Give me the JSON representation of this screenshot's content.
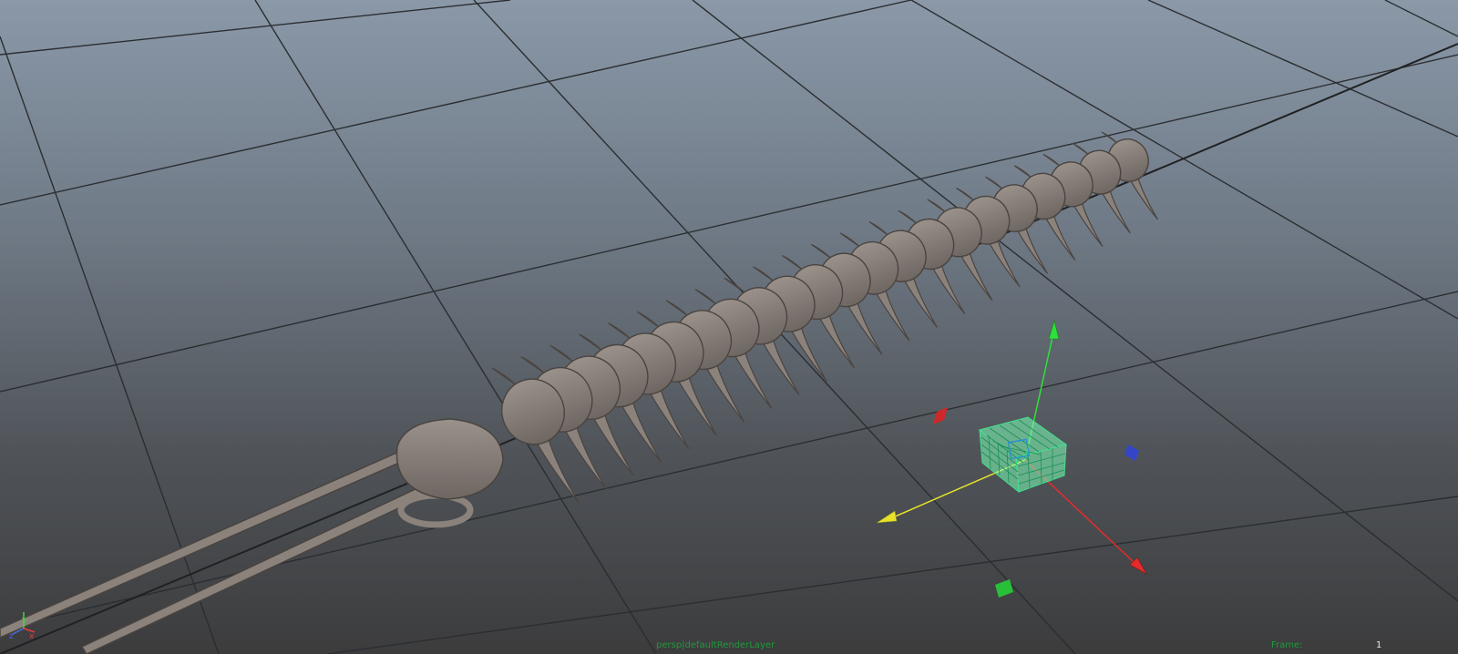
{
  "viewport": {
    "camera_label": "persp|defaultRenderLayer",
    "frame_label": "Frame:",
    "frame_value": "1"
  },
  "axis_indicator": {
    "x": "x",
    "y": "y",
    "z": "z"
  },
  "colors": {
    "grid": "#2a2d30",
    "model": "#8b827c",
    "model_edge": "#4a4440",
    "manip_x": "#e62b2b",
    "manip_y": "#2ee03a",
    "manip_z": "#3445c8",
    "manip_view": "#e6e22a",
    "selection_cube": "#7dffb8",
    "hud_text": "#1f9a3a"
  },
  "icons": {
    "move_manipulator": "move-manipulator-icon",
    "view_axis": "view-axis-icon"
  }
}
